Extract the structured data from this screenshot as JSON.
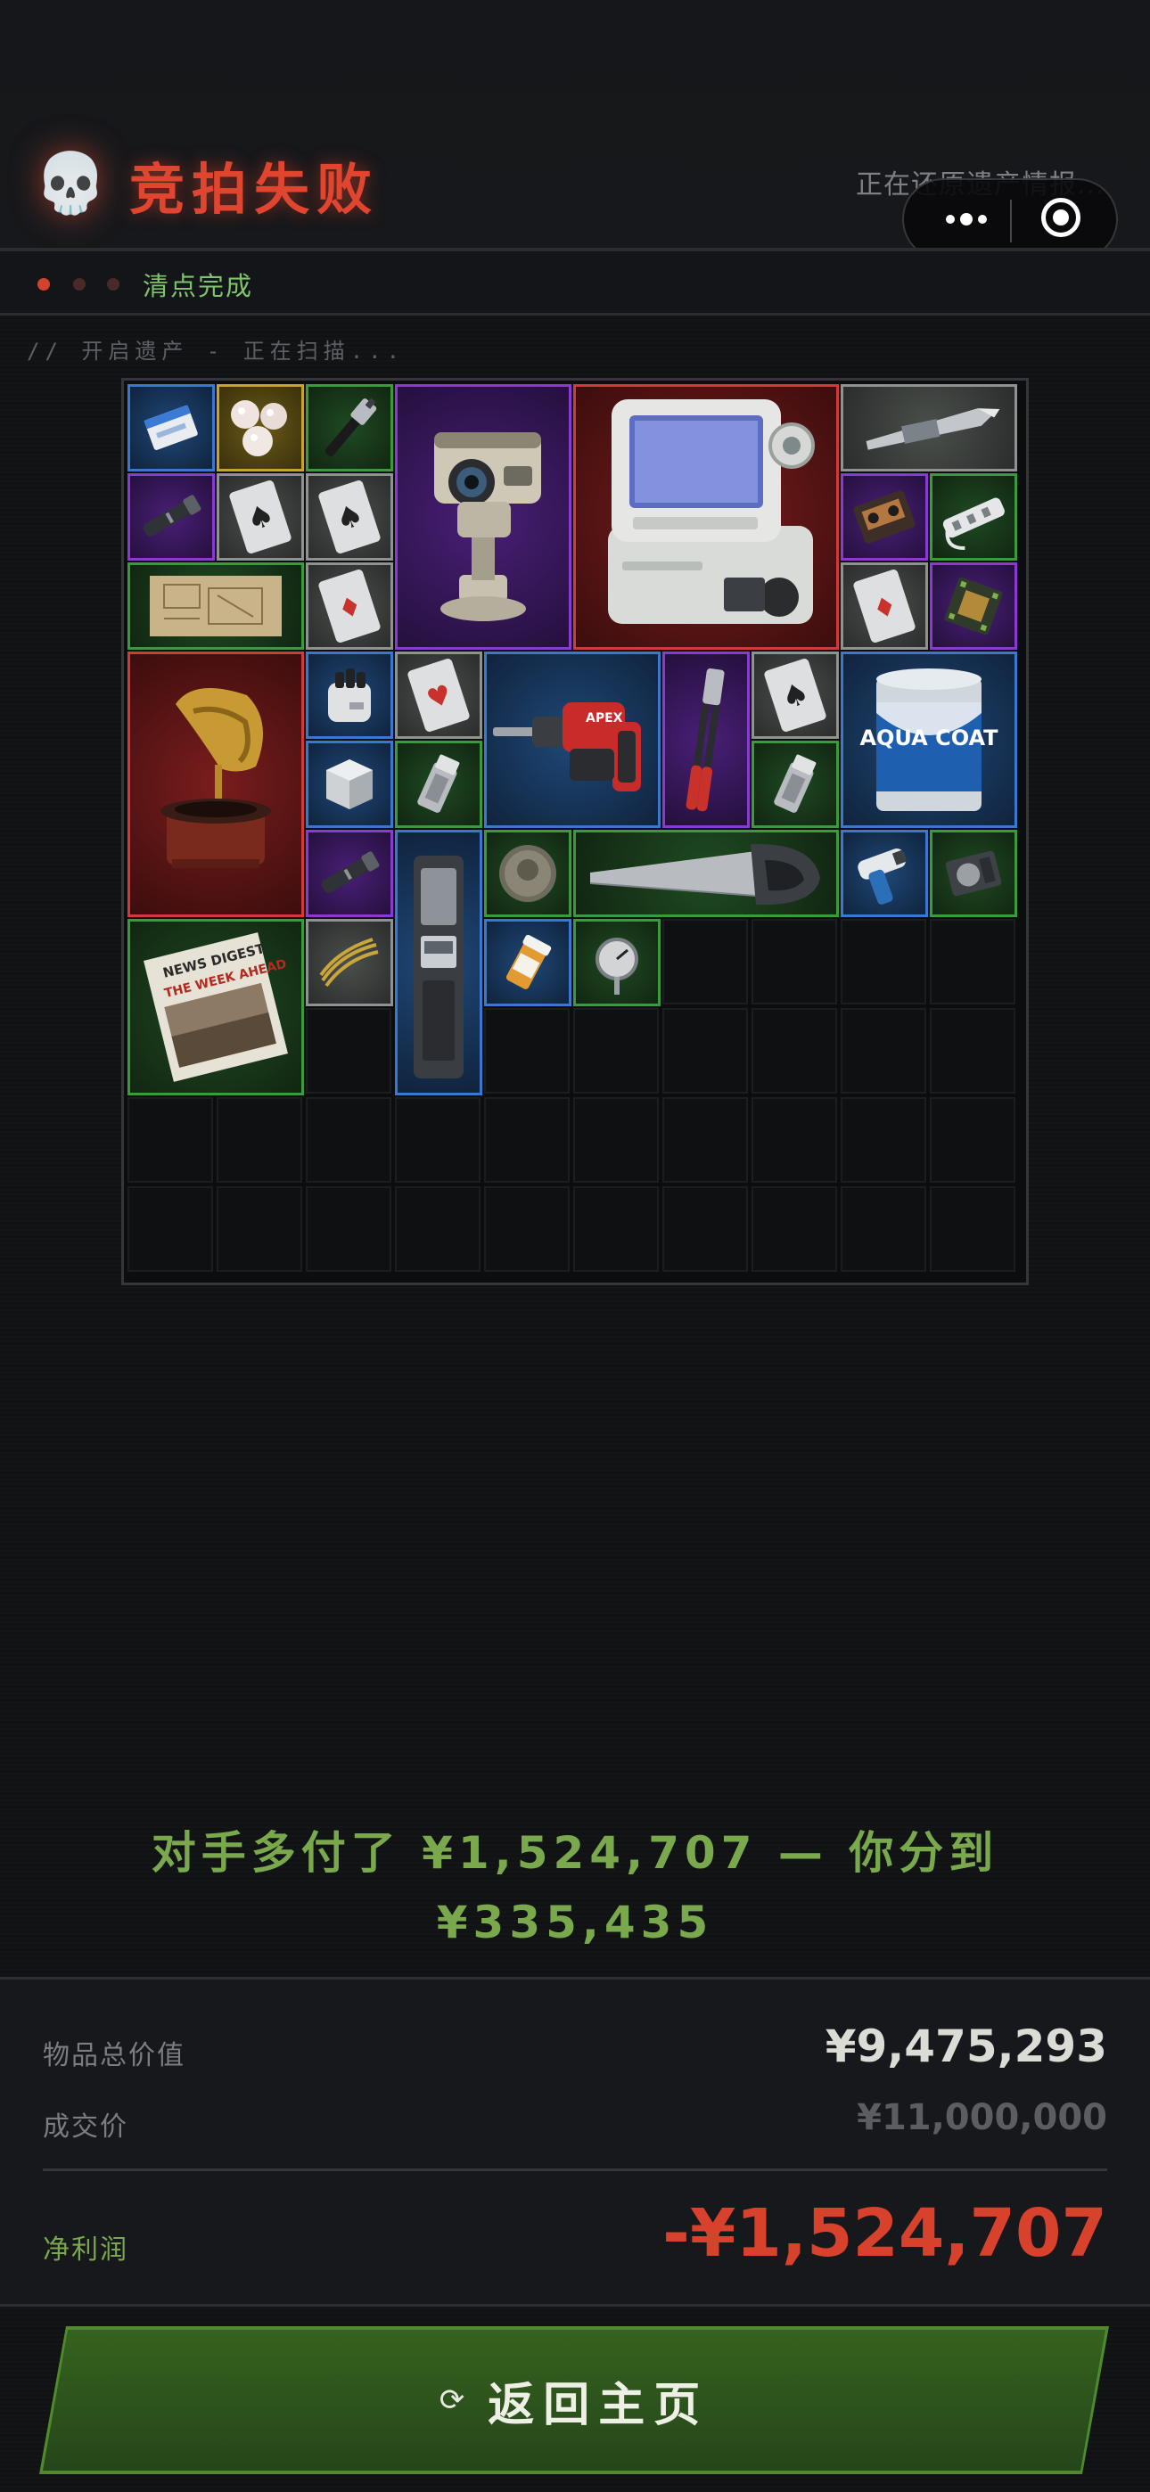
{
  "header": {
    "title": "竞拍失败",
    "restoring_text": "正在还原遗产情报...",
    "status_text": "清点完成"
  },
  "scan_text": "// 开启遗产 - 正在扫描...",
  "grid": {
    "items": [
      {
        "name": "cigarette-pack-item",
        "rarity": "blue"
      },
      {
        "name": "pearls-item",
        "rarity": "gold"
      },
      {
        "name": "wrench-item",
        "rarity": "green"
      },
      {
        "name": "pan-tilt-camera-item",
        "rarity": "purple"
      },
      {
        "name": "medical-monitor-item",
        "rarity": "red"
      },
      {
        "name": "utility-knife-item",
        "rarity": "gray"
      },
      {
        "name": "flashlight-item",
        "rarity": "purple"
      },
      {
        "name": "playing-card-spades-item",
        "rarity": "gray"
      },
      {
        "name": "playing-card-spades-item",
        "rarity": "gray"
      },
      {
        "name": "cassette-tape-item",
        "rarity": "purple"
      },
      {
        "name": "power-strip-item",
        "rarity": "green"
      },
      {
        "name": "blueprint-map-item",
        "rarity": "green"
      },
      {
        "name": "playing-card-diamond-item",
        "rarity": "gray"
      },
      {
        "name": "playing-card-diamond-item",
        "rarity": "gray"
      },
      {
        "name": "circuit-board-item",
        "rarity": "purple"
      },
      {
        "name": "gramophone-item",
        "rarity": "red"
      },
      {
        "name": "knob-canister-item",
        "rarity": "blue"
      },
      {
        "name": "playing-card-hearts-item",
        "rarity": "gray"
      },
      {
        "name": "rotary-hammer-drill-item",
        "rarity": "blue"
      },
      {
        "name": "bolt-cutter-item",
        "rarity": "purple"
      },
      {
        "name": "playing-card-spades-item",
        "rarity": "gray"
      },
      {
        "name": "paint-can-item",
        "rarity": "blue"
      },
      {
        "name": "cube-canister-item",
        "rarity": "blue"
      },
      {
        "name": "lighter-item",
        "rarity": "green"
      },
      {
        "name": "lighter-item",
        "rarity": "green"
      },
      {
        "name": "flashlight-item",
        "rarity": "purple"
      },
      {
        "name": "recorder-device-item",
        "rarity": "blue"
      },
      {
        "name": "coin-item",
        "rarity": "green"
      },
      {
        "name": "hand-saw-item",
        "rarity": "green"
      },
      {
        "name": "thermometer-gun-item",
        "rarity": "blue"
      },
      {
        "name": "hard-drive-item",
        "rarity": "green"
      },
      {
        "name": "newspaper-item",
        "rarity": "green"
      },
      {
        "name": "rope-item",
        "rarity": "gray"
      },
      {
        "name": "pill-bottle-item",
        "rarity": "blue"
      },
      {
        "name": "gauge-thermometer-item",
        "rarity": "green"
      }
    ],
    "paint_can_text": "AQUA COAT",
    "newspaper_text": "NEWS DIGEST",
    "newspaper_headline": "THE WEEK AHEAD",
    "drill_brand": "APEX"
  },
  "result": {
    "line1": "对手多付了 ¥1,524,707 — 你分到",
    "line2": "¥335,435"
  },
  "summary": {
    "total_label": "物品总价值",
    "total_value": "¥9,475,293",
    "deal_label": "成交价",
    "deal_value": "¥11,000,000",
    "profit_label": "净利润",
    "profit_value": "-¥1,524,707"
  },
  "button": {
    "icon": "⟳",
    "label": "返回主页"
  },
  "colors": {
    "accent_red": "#e0452f",
    "accent_green": "#7fc36a",
    "profit_red": "#d8412c"
  }
}
